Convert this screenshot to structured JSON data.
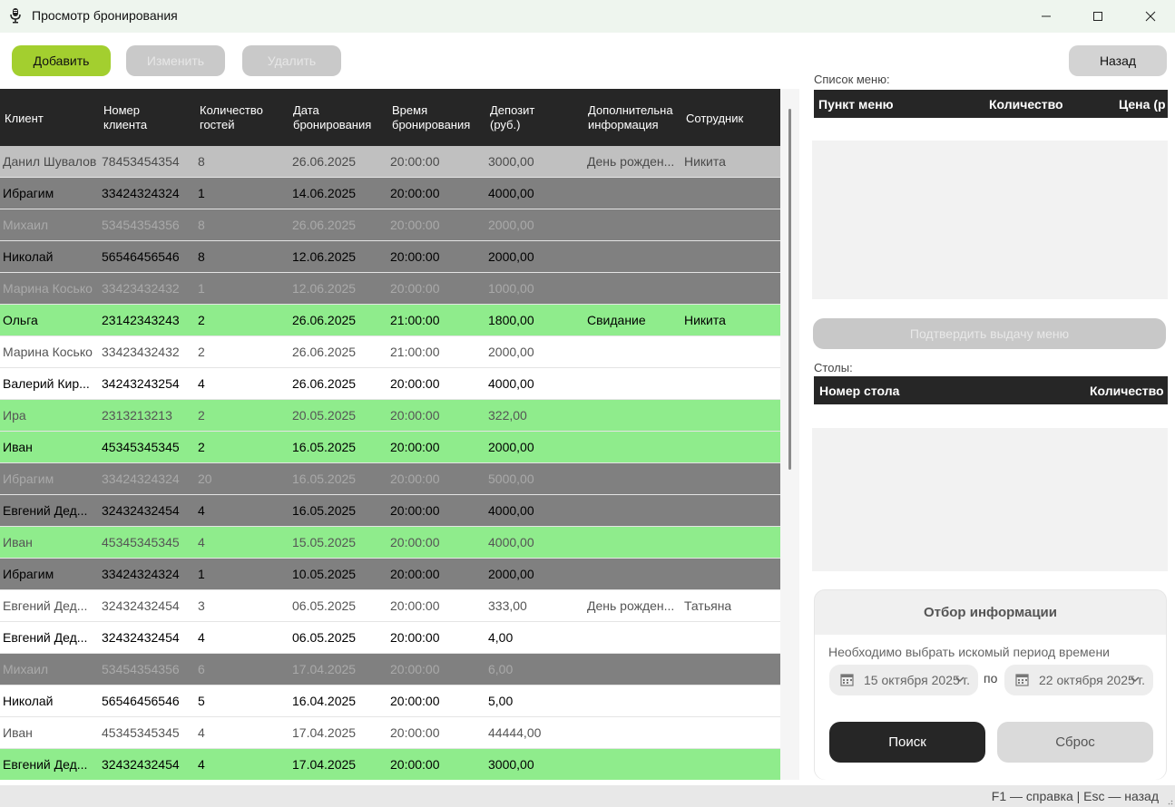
{
  "window": {
    "title": "Просмотр бронирования"
  },
  "toolbar": {
    "add": "Добавить",
    "edit": "Изменить",
    "delete": "Удалить",
    "back": "Назад"
  },
  "grid": {
    "columns": [
      [
        "Клиент"
      ],
      [
        "Номер",
        "клиента"
      ],
      [
        "Количество",
        "гостей"
      ],
      [
        "Дата",
        "бронирования"
      ],
      [
        "Время",
        "бронирования"
      ],
      [
        "Депозит",
        "(руб.)"
      ],
      [
        "Дополнительна",
        "информация"
      ],
      [
        "Сотрудник"
      ]
    ],
    "rows": [
      {
        "bg": "silver",
        "text": "dim",
        "cells": [
          "Данил Шувалов",
          "78453454354",
          "8",
          "26.06.2025",
          "20:00:00",
          "3000,00",
          "День рожден...",
          "Никита"
        ]
      },
      {
        "bg": "gray",
        "text": "bold",
        "cells": [
          "Ибрагим",
          "33424324324",
          "1",
          "14.06.2025",
          "20:00:00",
          "4000,00",
          "",
          ""
        ]
      },
      {
        "bg": "gray",
        "text": "faded",
        "cells": [
          "Михаил",
          "53454354356",
          "8",
          "26.06.2025",
          "20:00:00",
          "2000,00",
          "",
          ""
        ]
      },
      {
        "bg": "gray",
        "text": "bold",
        "cells": [
          "Николай",
          "56546456546",
          "8",
          "12.06.2025",
          "20:00:00",
          "2000,00",
          "",
          ""
        ]
      },
      {
        "bg": "gray",
        "text": "faded",
        "cells": [
          "Марина Косько",
          "33423432432",
          "1",
          "12.06.2025",
          "20:00:00",
          "1000,00",
          "",
          ""
        ]
      },
      {
        "bg": "green",
        "text": "bold",
        "cells": [
          "Ольга",
          "23142343243",
          "2",
          "26.06.2025",
          "21:00:00",
          "1800,00",
          "Свидание",
          "Никита"
        ]
      },
      {
        "bg": "white",
        "text": "muted",
        "cells": [
          "Марина Косько",
          "33423432432",
          "2",
          "26.06.2025",
          "21:00:00",
          "2000,00",
          "",
          ""
        ]
      },
      {
        "bg": "white",
        "text": "bold",
        "cells": [
          "Валерий Кир...",
          "34243243254",
          "4",
          "26.06.2025",
          "20:00:00",
          "4000,00",
          "",
          ""
        ]
      },
      {
        "bg": "green",
        "text": "muted",
        "cells": [
          "Ира",
          "2313213213",
          "2",
          "20.05.2025",
          "20:00:00",
          "322,00",
          "",
          ""
        ]
      },
      {
        "bg": "green",
        "text": "bold",
        "cells": [
          "Иван",
          "45345345345",
          "2",
          "16.05.2025",
          "20:00:00",
          "2000,00",
          "",
          ""
        ]
      },
      {
        "bg": "gray",
        "text": "faded",
        "cells": [
          "Ибрагим",
          "33424324324",
          "20",
          "16.05.2025",
          "20:00:00",
          "5000,00",
          "",
          ""
        ]
      },
      {
        "bg": "gray",
        "text": "bold",
        "cells": [
          "Евгений Дед...",
          "32432432454",
          "4",
          "16.05.2025",
          "20:00:00",
          "4000,00",
          "",
          ""
        ]
      },
      {
        "bg": "green",
        "text": "muted",
        "cells": [
          "Иван",
          "45345345345",
          "4",
          "15.05.2025",
          "20:00:00",
          "4000,00",
          "",
          ""
        ]
      },
      {
        "bg": "gray",
        "text": "bold",
        "cells": [
          "Ибрагим",
          "33424324324",
          "1",
          "10.05.2025",
          "20:00:00",
          "2000,00",
          "",
          ""
        ]
      },
      {
        "bg": "white",
        "text": "muted",
        "cells": [
          "Евгений Дед...",
          "32432432454",
          "3",
          "06.05.2025",
          "20:00:00",
          "333,00",
          "День рожден...",
          "Татьяна"
        ]
      },
      {
        "bg": "white",
        "text": "bold",
        "cells": [
          "Евгений Дед...",
          "32432432454",
          "4",
          "06.05.2025",
          "20:00:00",
          "4,00",
          "",
          ""
        ]
      },
      {
        "bg": "gray",
        "text": "faded",
        "cells": [
          "Михаил",
          "53454354356",
          "6",
          "17.04.2025",
          "20:00:00",
          "6,00",
          "",
          ""
        ]
      },
      {
        "bg": "white",
        "text": "bold",
        "cells": [
          "Николай",
          "56546456546",
          "5",
          "16.04.2025",
          "20:00:00",
          "5,00",
          "",
          ""
        ]
      },
      {
        "bg": "white",
        "text": "muted",
        "cells": [
          "Иван",
          "45345345345",
          "4",
          "17.04.2025",
          "20:00:00",
          "44444,00",
          "",
          ""
        ]
      },
      {
        "bg": "green",
        "text": "bold",
        "cells": [
          "Евгений Дед...",
          "32432432454",
          "4",
          "17.04.2025",
          "20:00:00",
          "3000,00",
          "",
          ""
        ]
      }
    ]
  },
  "menu": {
    "label": "Список меню:",
    "columns": [
      "Пункт меню",
      "Количество",
      "Цена (р"
    ],
    "confirm": "Подтвердить выдачу меню"
  },
  "tables": {
    "label": "Столы:",
    "columns": [
      "Номер стола",
      "Количество"
    ]
  },
  "filter": {
    "title": "Отбор информации",
    "hint": "Необходимо выбрать искомый период времени",
    "from": "15 октября 2025 г.",
    "to": "22 октября 2025 г.",
    "between": "по",
    "search": "Поиск",
    "reset": "Сброс"
  },
  "status": {
    "text": "F1 — справка  |  Esc — назад"
  },
  "colors": {
    "accent": "#a3cf2f",
    "header": "#262626",
    "row_gray": "#808080",
    "row_green": "#8fec8c",
    "row_silver": "#c0c0c0"
  },
  "icons": {
    "app": "microphone-icon",
    "minimize": "minimize-icon",
    "maximize": "maximize-icon",
    "close": "close-icon",
    "calendar": "calendar-icon",
    "chevron": "chevron-down-icon"
  }
}
